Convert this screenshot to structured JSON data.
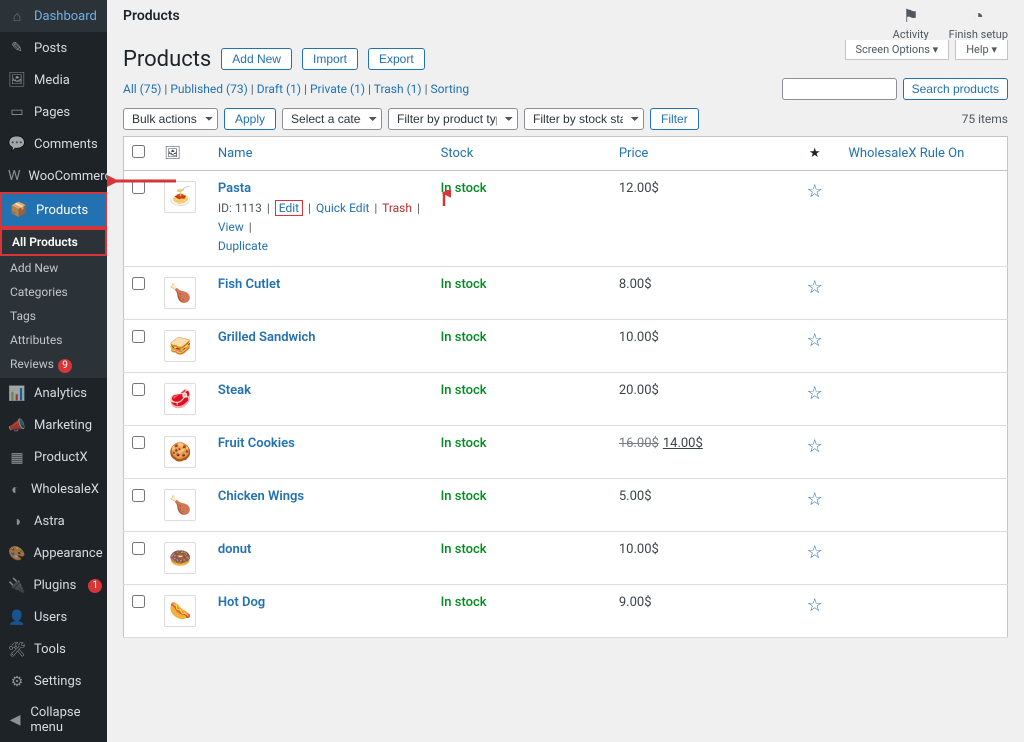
{
  "sidebar": {
    "items": [
      {
        "icon": "⌂",
        "label": "Dashboard"
      },
      {
        "icon": "✎",
        "label": "Posts"
      },
      {
        "icon": "🖼",
        "label": "Media"
      },
      {
        "icon": "▭",
        "label": "Pages"
      },
      {
        "icon": "💬",
        "label": "Comments"
      },
      {
        "icon": "W",
        "label": "WooCommerce",
        "faint": true
      },
      {
        "icon": "📦",
        "label": "Products",
        "active": true,
        "hl": true
      },
      {
        "icon": "📊",
        "label": "Analytics"
      },
      {
        "icon": "📣",
        "label": "Marketing"
      },
      {
        "icon": "▦",
        "label": "ProductX"
      },
      {
        "icon": "◐",
        "label": "WholesaleX"
      },
      {
        "icon": "◑",
        "label": "Astra"
      },
      {
        "icon": "🎨",
        "label": "Appearance"
      },
      {
        "icon": "🔌",
        "label": "Plugins",
        "badge": "1"
      },
      {
        "icon": "👤",
        "label": "Users"
      },
      {
        "icon": "🛠",
        "label": "Tools"
      },
      {
        "icon": "⚙",
        "label": "Settings"
      },
      {
        "icon": "◀",
        "label": "Collapse menu",
        "faint": true
      }
    ],
    "submenu": [
      {
        "label": "All Products",
        "current": true,
        "hl": true
      },
      {
        "label": "Add New"
      },
      {
        "label": "Categories"
      },
      {
        "label": "Tags"
      },
      {
        "label": "Attributes"
      },
      {
        "label": "Reviews",
        "badge": "9"
      }
    ]
  },
  "header": {
    "breadcrumb": "Products",
    "activity": "Activity",
    "finish": "Finish setup",
    "screen_options": "Screen Options ▾",
    "help": "Help ▾"
  },
  "title": {
    "page_title": "Products",
    "add_new": "Add New",
    "import": "Import",
    "export": "Export"
  },
  "status_links": {
    "all": "All (75)",
    "published": "Published (73)",
    "draft": "Draft (1)",
    "private": "Private (1)",
    "trash": "Trash (1)",
    "sorting": "Sorting"
  },
  "search": {
    "placeholder": "",
    "button": "Search products"
  },
  "actions": {
    "bulk": "Bulk actions",
    "apply": "Apply",
    "category": "Select a category",
    "ptype": "Filter by product type",
    "stock": "Filter by stock status",
    "filter": "Filter",
    "items": "75 items"
  },
  "columns": {
    "img": "🖼",
    "name": "Name",
    "stock": "Stock",
    "price": "Price",
    "star": "★",
    "rule": "WholesaleX Rule On"
  },
  "row_actions": {
    "id_prefix": "ID: 1113",
    "edit": "Edit",
    "quick": "Quick Edit",
    "trash": "Trash",
    "view": "View",
    "dup": "Duplicate"
  },
  "products": [
    {
      "thumb": "🍝",
      "name": "Pasta",
      "stock": "In stock",
      "price": "12.00$",
      "show_actions": true,
      "thumb_color": "#d4a84b"
    },
    {
      "thumb": "🍗",
      "name": "Fish Cutlet",
      "stock": "In stock",
      "price": "8.00$"
    },
    {
      "thumb": "🥪",
      "name": "Grilled Sandwich",
      "stock": "In stock",
      "price": "10.00$"
    },
    {
      "thumb": "🥩",
      "name": "Steak",
      "stock": "In stock",
      "price": "20.00$"
    },
    {
      "thumb": "🍪",
      "name": "Fruit Cookies",
      "stock": "In stock",
      "price": "16.00$",
      "sale": "14.00$"
    },
    {
      "thumb": "🍗",
      "name": "Chicken Wings",
      "stock": "In stock",
      "price": "5.00$"
    },
    {
      "thumb": "🍩",
      "name": "donut",
      "stock": "In stock",
      "price": "10.00$"
    },
    {
      "thumb": "🌭",
      "name": "Hot Dog",
      "stock": "In stock",
      "price": "9.00$"
    }
  ]
}
